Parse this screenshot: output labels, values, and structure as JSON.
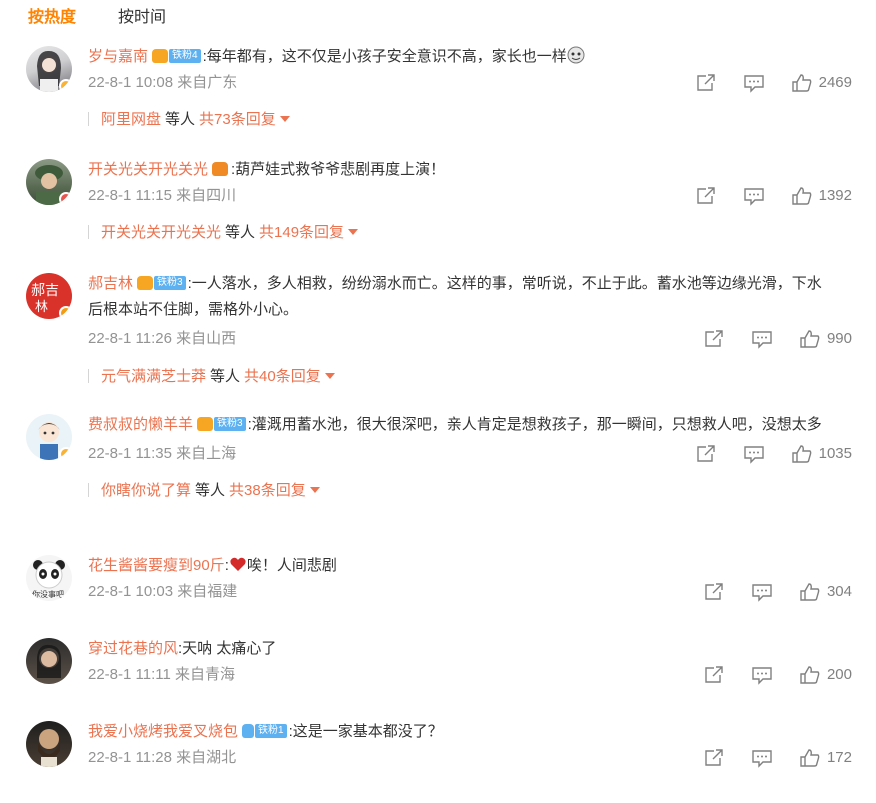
{
  "tabs": {
    "hot": "按热度",
    "time": "按时间"
  },
  "comments": [
    {
      "user": "岁与嘉南",
      "badge_level": "铁粉4",
      "text": ":每年都有，这不仅是小孩子安全意识不高，家长也一样",
      "meta": "22-8-1 10:08 来自广东",
      "likes": "2469",
      "reply_user": "阿里网盘",
      "reply_etc": "等人",
      "reply_total": "共73条回复"
    },
    {
      "user": "开关光关开光关光",
      "badge_level": "",
      "text": ":葫芦娃式救爷爷悲剧再度上演！",
      "meta": "22-8-1 11:15 来自四川",
      "likes": "1392",
      "reply_user": "开关光关开光关光",
      "reply_etc": "等人",
      "reply_total": "共149条回复"
    },
    {
      "user": "郝吉林",
      "badge_level": "铁粉3",
      "text": ":一人落水，多人相救，纷纷溺水而亡。这样的事，常听说，不止于此。蓄水池等边缘光滑，下水后根本站不住脚，需格外小心。",
      "meta": "22-8-1 11:26 来自山西",
      "likes": "990",
      "reply_user": "元气满满芝士莽",
      "reply_etc": "等人",
      "reply_total": "共40条回复"
    },
    {
      "user": "费叔叔的懒羊羊",
      "badge_level": "铁粉3",
      "text": ":灌溉用蓄水池，很大很深吧，亲人肯定是想救孩子，那一瞬间，只想救人吧，没想太多",
      "meta": "22-8-1 11:35 来自上海",
      "likes": "1035",
      "reply_user": "你瞎你说了算",
      "reply_etc": "等人",
      "reply_total": "共38条回复"
    },
    {
      "user": "花生酱酱要瘦到90斤",
      "badge_level": "",
      "text": "唉！人间悲剧",
      "meta": "22-8-1 10:03 来自福建",
      "likes": "304"
    },
    {
      "user": "穿过花巷的风",
      "badge_level": "",
      "text": ":天呐  太痛心了",
      "meta": "22-8-1 11:11 来自青海",
      "likes": "200"
    },
    {
      "user": "我爱小烧烤我爱叉烧包",
      "badge_level": "铁粉1",
      "text": ":这是一家基本都没了？",
      "meta": "22-8-1 11:28 来自湖北",
      "likes": "172"
    }
  ]
}
